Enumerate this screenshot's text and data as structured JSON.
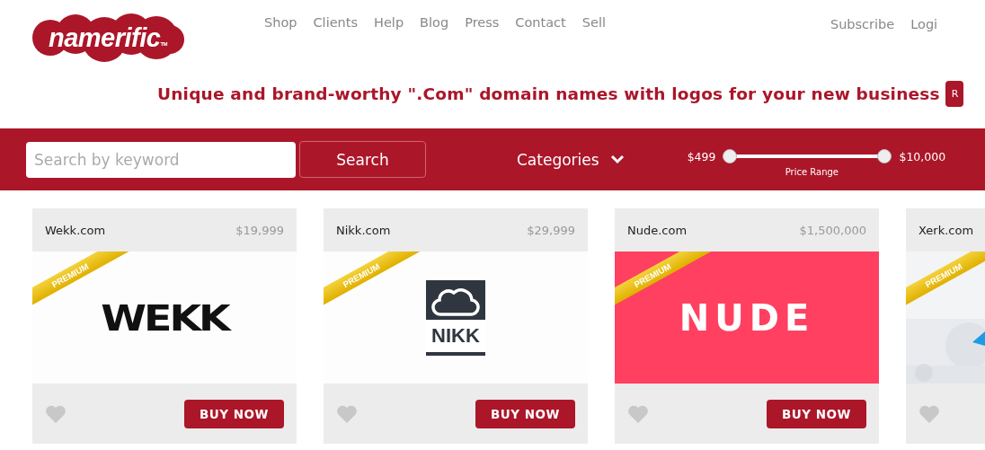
{
  "header": {
    "logo": {
      "text": "namerific",
      "mark": "TM"
    },
    "nav": [
      {
        "label": "Shop"
      },
      {
        "label": "Clients"
      },
      {
        "label": "Help"
      },
      {
        "label": "Blog"
      },
      {
        "label": "Press"
      },
      {
        "label": "Contact"
      },
      {
        "label": "Sell"
      }
    ],
    "account_links": [
      {
        "label": "Subscribe"
      },
      {
        "label": "Logi"
      }
    ],
    "tagline": "Unique and brand-worthy \".Com\" domain names with logos for your new business",
    "tagline_button": "R"
  },
  "search_bar": {
    "search": {
      "placeholder": "Search by keyword"
    },
    "search_button": "Search",
    "categories": "Categories",
    "price_range": {
      "min_label": "$499",
      "max_label": "$10,000",
      "caption": "Price Range",
      "thumbs": [
        {
          "level": 0
        },
        {
          "level": 1
        }
      ]
    }
  },
  "cards": [
    {
      "kind": "wordmark",
      "name": "Wekk.com",
      "price": "$19,999",
      "badge": "PREMIUM",
      "logo_text": "WEKK",
      "favorite": false,
      "button": "BUY NOW"
    },
    {
      "kind": "cloud",
      "name": "Nikk.com",
      "price": "$29,999",
      "badge": "PREMIUM",
      "logo_text": "NIKK",
      "favorite": false,
      "button": "BUY NOW"
    },
    {
      "kind": "rounded",
      "name": "Nude.com",
      "price": "$1,500,000",
      "badge": "PREMIUM",
      "logo_text": "NUDE",
      "favorite": false,
      "button": "BUY NOW"
    },
    {
      "kind": "picture",
      "name": "Xerk.com",
      "badge": "PREMIUM",
      "favorite": false
    }
  ]
}
